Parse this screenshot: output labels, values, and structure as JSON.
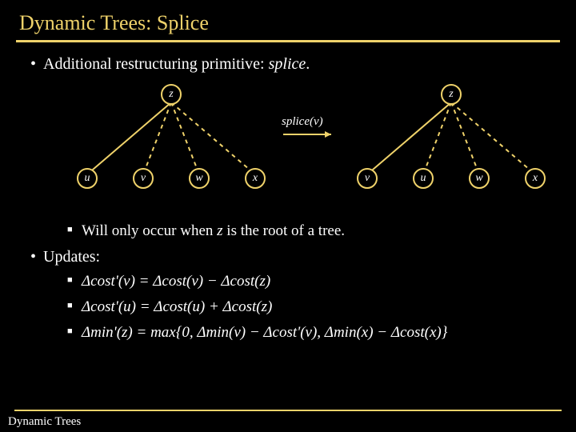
{
  "title": "Dynamic Trees: Splice",
  "footer": "Dynamic Trees",
  "bullets": {
    "intro": "Additional restructuring primitive: ",
    "intro_em": "splice",
    "intro_period": ".",
    "root_note": "Will only occur when ",
    "root_note_em": "z",
    "root_note_tail": " is the root of a tree.",
    "updates_label": "Updates:",
    "eq1": "Δcost'(v) = Δcost(v) − Δcost(z)",
    "eq2": "Δcost'(u) = Δcost(u) + Δcost(z)",
    "eq3": "Δmin'(z) = max{0, Δmin(v) − Δcost'(v), Δmin(x) − Δcost(x)}"
  },
  "diagram": {
    "op_label": "splice(v)",
    "left": {
      "root": "z",
      "children": [
        "u",
        "v",
        "w",
        "x"
      ],
      "solid_child_index": 0
    },
    "right": {
      "root": "z",
      "children": [
        "v",
        "u",
        "w",
        "x"
      ],
      "solid_child_index": 0
    }
  },
  "chart_data": {
    "type": "diagram",
    "description": "Two tree fragments showing splice(v) restructuring: left tree root z with solid edge to u and dashed edges to v,w,x; after splice(v) right tree root z with solid edge to v and dashed edges to u,w,x.",
    "before": {
      "root": "z",
      "solid": [
        "u"
      ],
      "dashed": [
        "v",
        "w",
        "x"
      ]
    },
    "after": {
      "root": "z",
      "solid": [
        "v"
      ],
      "dashed": [
        "u",
        "w",
        "x"
      ]
    }
  }
}
